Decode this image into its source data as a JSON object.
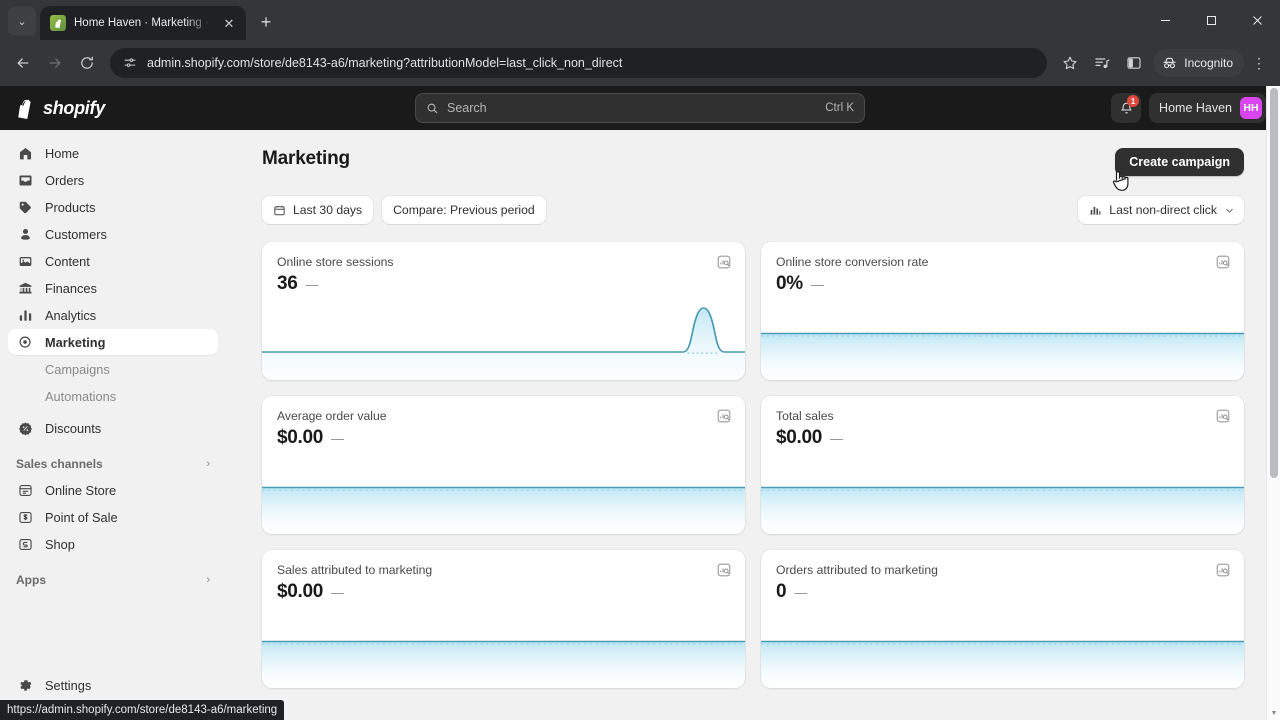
{
  "browser": {
    "tab": {
      "title": "Home Haven · Marketing · Shop",
      "favicon_name": "shopify-favicon",
      "close_label": "✕"
    },
    "new_tab_label": "+",
    "tabstrip_chevron": "⌄",
    "window_controls": {
      "minimize": "—",
      "maximize": "▢",
      "close": "✕"
    },
    "nav": {
      "back": "←",
      "forward": "→",
      "reload": "⟳"
    },
    "omnibox": {
      "url": "admin.shopify.com/store/de8143-a6/marketing?attributionModel=last_click_non_direct",
      "site_info_icon": "tune-icon",
      "bookmark_icon": "star-icon"
    },
    "toolbar_icons": [
      "playlist-icon",
      "split-view-icon"
    ],
    "incognito_label": "Incognito",
    "menu_label": "⋮",
    "statusbar_url": "https://admin.shopify.com/store/de8143-a6/marketing"
  },
  "topbar": {
    "brand": "shopify",
    "search": {
      "placeholder": "Search",
      "shortcut": "Ctrl K"
    },
    "notifications_count": "1",
    "store_name": "Home Haven",
    "avatar_initials": "HH"
  },
  "sidebar": {
    "items": [
      {
        "label": "Home",
        "icon": "home-icon",
        "active": false
      },
      {
        "label": "Orders",
        "icon": "orders-icon",
        "active": false
      },
      {
        "label": "Products",
        "icon": "products-tag-icon",
        "active": false
      },
      {
        "label": "Customers",
        "icon": "customers-person-icon",
        "active": false
      },
      {
        "label": "Content",
        "icon": "content-icon",
        "active": false
      },
      {
        "label": "Finances",
        "icon": "finances-bank-icon",
        "active": false
      },
      {
        "label": "Analytics",
        "icon": "analytics-bars-icon",
        "active": false
      },
      {
        "label": "Marketing",
        "icon": "marketing-target-icon",
        "active": true
      },
      {
        "label": "Discounts",
        "icon": "discounts-icon",
        "active": false
      }
    ],
    "marketing_children": [
      {
        "label": "Campaigns"
      },
      {
        "label": "Automations"
      }
    ],
    "sections": [
      {
        "title": "Sales channels",
        "chevron": "›",
        "items": [
          {
            "label": "Online Store",
            "icon": "online-store-icon"
          },
          {
            "label": "Point of Sale",
            "icon": "point-of-sale-icon"
          },
          {
            "label": "Shop",
            "icon": "shop-icon"
          }
        ]
      },
      {
        "title": "Apps",
        "chevron": "›",
        "items": []
      }
    ],
    "settings": {
      "label": "Settings",
      "icon": "gear-icon"
    }
  },
  "main": {
    "title": "Marketing",
    "create_campaign_label": "Create campaign",
    "date_filter": {
      "label": "Last 30 days",
      "icon": "calendar-icon"
    },
    "compare_filter": {
      "label": "Compare: Previous period"
    },
    "attribution": {
      "label": "Last non-direct click",
      "icon": "bar-chart-icon",
      "chevron": "⌄"
    },
    "report_icon_name": "view-report-icon",
    "cards": [
      {
        "label": "Online store sessions",
        "value": "36",
        "delta": "—"
      },
      {
        "label": "Online store conversion rate",
        "value": "0%",
        "delta": "—"
      },
      {
        "label": "Average order value",
        "value": "$0.00",
        "delta": "—"
      },
      {
        "label": "Total sales",
        "value": "$0.00",
        "delta": "—"
      },
      {
        "label": "Sales attributed to marketing",
        "value": "$0.00",
        "delta": "—"
      },
      {
        "label": "Orders attributed to marketing",
        "value": "0",
        "delta": "—"
      }
    ]
  },
  "chart_data": [
    {
      "type": "line",
      "title": "Online store sessions",
      "x": [
        0,
        1,
        2,
        3,
        4,
        5,
        6,
        7,
        8,
        9,
        10,
        11,
        12,
        13,
        14,
        15,
        16,
        17,
        18,
        19,
        20,
        21,
        22,
        23,
        24,
        25,
        26,
        27,
        28,
        29
      ],
      "values": [
        0,
        0,
        0,
        0,
        0,
        0,
        0,
        0,
        0,
        0,
        0,
        0,
        0,
        0,
        0,
        0,
        0,
        0,
        0,
        0,
        0,
        0,
        0,
        0,
        0,
        0,
        2,
        36,
        2,
        0
      ],
      "ylim": [
        0,
        36
      ],
      "grid": false,
      "legend": "none"
    },
    {
      "type": "line",
      "title": "Online store conversion rate",
      "x": [
        0,
        1,
        2,
        3,
        4,
        5,
        6,
        7,
        8,
        9,
        10,
        11,
        12,
        13,
        14,
        15,
        16,
        17,
        18,
        19,
        20,
        21,
        22,
        23,
        24,
        25,
        26,
        27,
        28,
        29
      ],
      "values": [
        0,
        0,
        0,
        0,
        0,
        0,
        0,
        0,
        0,
        0,
        0,
        0,
        0,
        0,
        0,
        0,
        0,
        0,
        0,
        0,
        0,
        0,
        0,
        0,
        0,
        0,
        0,
        0,
        0,
        0
      ],
      "ylim": [
        0,
        0
      ],
      "grid": false,
      "legend": "none"
    },
    {
      "type": "line",
      "title": "Average order value",
      "x": [
        0,
        1,
        2,
        3,
        4,
        5,
        6,
        7,
        8,
        9,
        10,
        11,
        12,
        13,
        14,
        15,
        16,
        17,
        18,
        19,
        20,
        21,
        22,
        23,
        24,
        25,
        26,
        27,
        28,
        29
      ],
      "values": [
        0,
        0,
        0,
        0,
        0,
        0,
        0,
        0,
        0,
        0,
        0,
        0,
        0,
        0,
        0,
        0,
        0,
        0,
        0,
        0,
        0,
        0,
        0,
        0,
        0,
        0,
        0,
        0,
        0,
        0
      ],
      "ylim": [
        0,
        0
      ],
      "grid": false,
      "legend": "none"
    },
    {
      "type": "line",
      "title": "Total sales",
      "x": [
        0,
        1,
        2,
        3,
        4,
        5,
        6,
        7,
        8,
        9,
        10,
        11,
        12,
        13,
        14,
        15,
        16,
        17,
        18,
        19,
        20,
        21,
        22,
        23,
        24,
        25,
        26,
        27,
        28,
        29
      ],
      "values": [
        0,
        0,
        0,
        0,
        0,
        0,
        0,
        0,
        0,
        0,
        0,
        0,
        0,
        0,
        0,
        0,
        0,
        0,
        0,
        0,
        0,
        0,
        0,
        0,
        0,
        0,
        0,
        0,
        0,
        0
      ],
      "ylim": [
        0,
        0
      ],
      "grid": false,
      "legend": "none"
    },
    {
      "type": "line",
      "title": "Sales attributed to marketing",
      "x": [
        0,
        1,
        2,
        3,
        4,
        5,
        6,
        7,
        8,
        9,
        10,
        11,
        12,
        13,
        14,
        15,
        16,
        17,
        18,
        19,
        20,
        21,
        22,
        23,
        24,
        25,
        26,
        27,
        28,
        29
      ],
      "values": [
        0,
        0,
        0,
        0,
        0,
        0,
        0,
        0,
        0,
        0,
        0,
        0,
        0,
        0,
        0,
        0,
        0,
        0,
        0,
        0,
        0,
        0,
        0,
        0,
        0,
        0,
        0,
        0,
        0,
        0
      ],
      "ylim": [
        0,
        0
      ],
      "grid": false,
      "legend": "none"
    },
    {
      "type": "line",
      "title": "Orders attributed to marketing",
      "x": [
        0,
        1,
        2,
        3,
        4,
        5,
        6,
        7,
        8,
        9,
        10,
        11,
        12,
        13,
        14,
        15,
        16,
        17,
        18,
        19,
        20,
        21,
        22,
        23,
        24,
        25,
        26,
        27,
        28,
        29
      ],
      "values": [
        0,
        0,
        0,
        0,
        0,
        0,
        0,
        0,
        0,
        0,
        0,
        0,
        0,
        0,
        0,
        0,
        0,
        0,
        0,
        0,
        0,
        0,
        0,
        0,
        0,
        0,
        0,
        0,
        0,
        0
      ],
      "ylim": [
        0,
        0
      ],
      "grid": false,
      "legend": "none"
    }
  ],
  "colors": {
    "accent_line": "#4a9bb5",
    "fill": "#cfeaf5",
    "primary_button": "#303030",
    "avatar": "#d946ef",
    "badge": "#e0483e"
  }
}
